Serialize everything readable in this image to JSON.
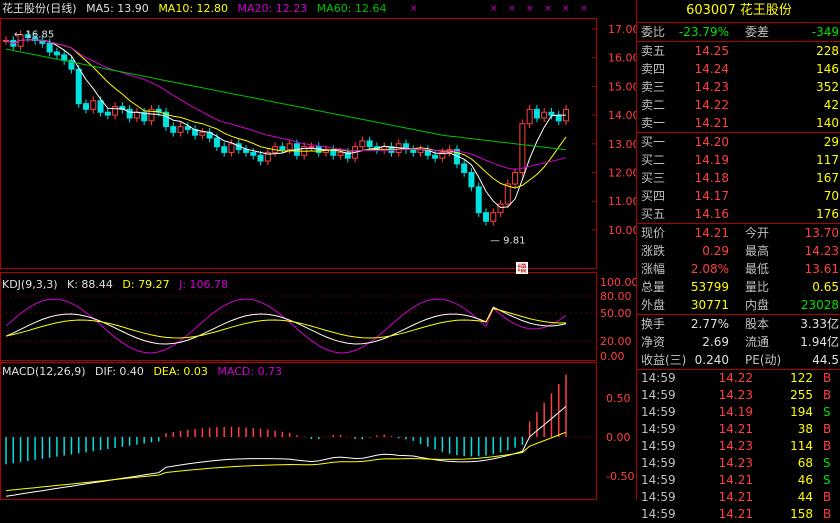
{
  "header": {
    "name": "花王股份(日线)",
    "ma5": "MA5: 13.90",
    "ma10": "MA10: 12.80",
    "ma20": "MA20: 12.23",
    "ma60": "MA60: 12.64",
    "high_label": "16.85",
    "low_label": "9.81",
    "marker": "增",
    "x_mark": "×"
  },
  "kdj_header": {
    "name": "KDJ(9,3,3)",
    "k": "K: 88.44",
    "d": "D: 79.27",
    "j": "J: 106.78"
  },
  "macd_header": {
    "name": "MACD(12,26,9)",
    "dif": "DIF: 0.40",
    "dea": "DEA: 0.03",
    "macd": "MACD: 0.73"
  },
  "price_axis": [
    "17.00",
    "16.00",
    "15.00",
    "14.00",
    "13.00",
    "12.00",
    "11.00",
    "10.00"
  ],
  "kdj_axis": [
    "100.00",
    "80.00",
    "50.00",
    "20.00",
    "0.00"
  ],
  "macd_axis": [
    "0.50",
    "0.00",
    "-0.50"
  ],
  "panel": {
    "code": "603007",
    "stock_name": "花王股份",
    "ratio": {
      "l": "委比",
      "v": "-23.79%",
      "l2": "委差",
      "v2": "-349"
    },
    "asks": [
      {
        "l": "卖五",
        "p": "14.25",
        "q": "228"
      },
      {
        "l": "卖四",
        "p": "14.24",
        "q": "146"
      },
      {
        "l": "卖三",
        "p": "14.23",
        "q": "352"
      },
      {
        "l": "卖二",
        "p": "14.22",
        "q": "42"
      },
      {
        "l": "卖一",
        "p": "14.21",
        "q": "140"
      }
    ],
    "bids": [
      {
        "l": "买一",
        "p": "14.20",
        "q": "29"
      },
      {
        "l": "买二",
        "p": "14.19",
        "q": "117"
      },
      {
        "l": "买三",
        "p": "14.18",
        "q": "167"
      },
      {
        "l": "买四",
        "p": "14.17",
        "q": "70"
      },
      {
        "l": "买五",
        "p": "14.16",
        "q": "176"
      }
    ],
    "quote1": [
      {
        "l": "现价",
        "v": "14.21",
        "l2": "今开",
        "v2": "13.70"
      },
      {
        "l": "涨跌",
        "v": "0.29",
        "l2": "最高",
        "v2": "14.23"
      },
      {
        "l": "涨幅",
        "v": "2.08%",
        "l2": "最低",
        "v2": "13.61"
      },
      {
        "l": "总量",
        "v": "53799",
        "l2": "量比",
        "v2": "0.65"
      },
      {
        "l": "外盘",
        "v": "30771",
        "l2": "内盘",
        "v2": "23028"
      }
    ],
    "quote2": [
      {
        "l": "换手",
        "v": "2.77%",
        "l2": "股本",
        "v2": "3.33亿"
      },
      {
        "l": "净资",
        "v": "2.69",
        "l2": "流通",
        "v2": "1.94亿"
      },
      {
        "l": "收益(三)",
        "v": "0.240",
        "l2": "PE(动)",
        "v2": "44.5"
      }
    ],
    "trades": [
      {
        "t": "14:59",
        "p": "14.22",
        "v": "122",
        "s": "B"
      },
      {
        "t": "14:59",
        "p": "14.23",
        "v": "255",
        "s": "B"
      },
      {
        "t": "14:59",
        "p": "14.19",
        "v": "194",
        "s": "S"
      },
      {
        "t": "14:59",
        "p": "14.21",
        "v": "38",
        "s": "B"
      },
      {
        "t": "14:59",
        "p": "14.23",
        "v": "114",
        "s": "B"
      },
      {
        "t": "14:59",
        "p": "14.23",
        "v": "68",
        "s": "S"
      },
      {
        "t": "14:59",
        "p": "14.21",
        "v": "46",
        "s": "S"
      },
      {
        "t": "14:59",
        "p": "14.21",
        "v": "44",
        "s": "B"
      },
      {
        "t": "14:59",
        "p": "14.21",
        "v": "158",
        "s": "B"
      }
    ]
  },
  "colors": {
    "up": "#ff4040",
    "down": "#00e0e0",
    "ma5": "#ffffff",
    "ma10": "#ffff00",
    "ma20": "#d000d0",
    "ma60": "#00c000",
    "border": "#b00000"
  }
}
